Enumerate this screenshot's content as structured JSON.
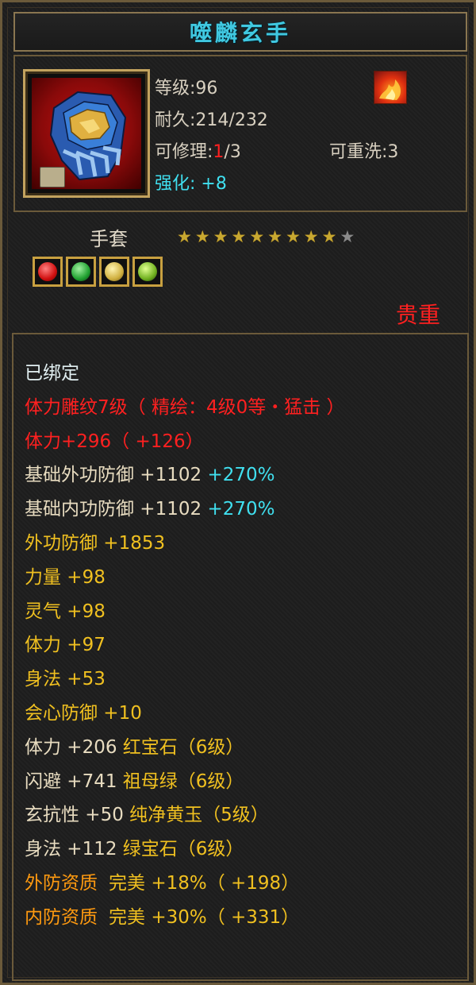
{
  "item": {
    "name": "噬麟玄手",
    "level": "等级:96",
    "durability": "耐久:214/232",
    "repair_prefix": "可修理:",
    "repair_current": "1",
    "repair_max": "/3",
    "rewash": "可重洗:3",
    "enhance_label": "强化:",
    "enhance_value": "+8",
    "type": "手套",
    "rarity": "贵重",
    "stars_filled": 9,
    "stars_total": 10
  },
  "icons": {
    "item_icon": "gauntlet-icon",
    "buff_icon": "flame-icon",
    "bind_badge": "bind-lock-icon",
    "gems": [
      "red-gem-icon",
      "green-gem-icon",
      "yellow-gem-icon",
      "emerald-gem-icon"
    ]
  },
  "colors": {
    "title": "#40c8e0",
    "red": "#ff2020",
    "cyan": "#40e0f0",
    "yellow": "#f0c020",
    "orange": "#ff9a10",
    "border": "#6b5a3a"
  },
  "attributes": {
    "bound": "已绑定",
    "engraving": "体力雕纹7级（ 精绘：4级0等・猛击 ）",
    "stamina_base": "体力+296（ +126）",
    "base_ext_def": "基础外功防御 +1102",
    "base_ext_def_pct": "+270%",
    "base_int_def": "基础内功防御 +1102",
    "base_int_def_pct": "+270%",
    "ext_def": "外功防御 +1853",
    "strength": "力量 +98",
    "spirit": "灵气 +98",
    "stamina": "体力 +97",
    "agility": "身法 +53",
    "crit_def": "会心防御 +10",
    "gem1_stat": "体力 +206",
    "gem1_name": "红宝石（6级）",
    "gem2_stat": "闪避 +741",
    "gem2_name": "祖母绿（6级）",
    "gem3_stat": "玄抗性 +50",
    "gem3_name": "纯净黄玉（5级）",
    "gem4_stat": "身法 +112",
    "gem4_name": "绿宝石（6级）",
    "q1_label": "外防资质",
    "q1_grade": "完美",
    "q1_value": "+18%（ +198）",
    "q2_label": "内防资质",
    "q2_grade": "完美",
    "q2_value": "+30%（ +331）"
  }
}
